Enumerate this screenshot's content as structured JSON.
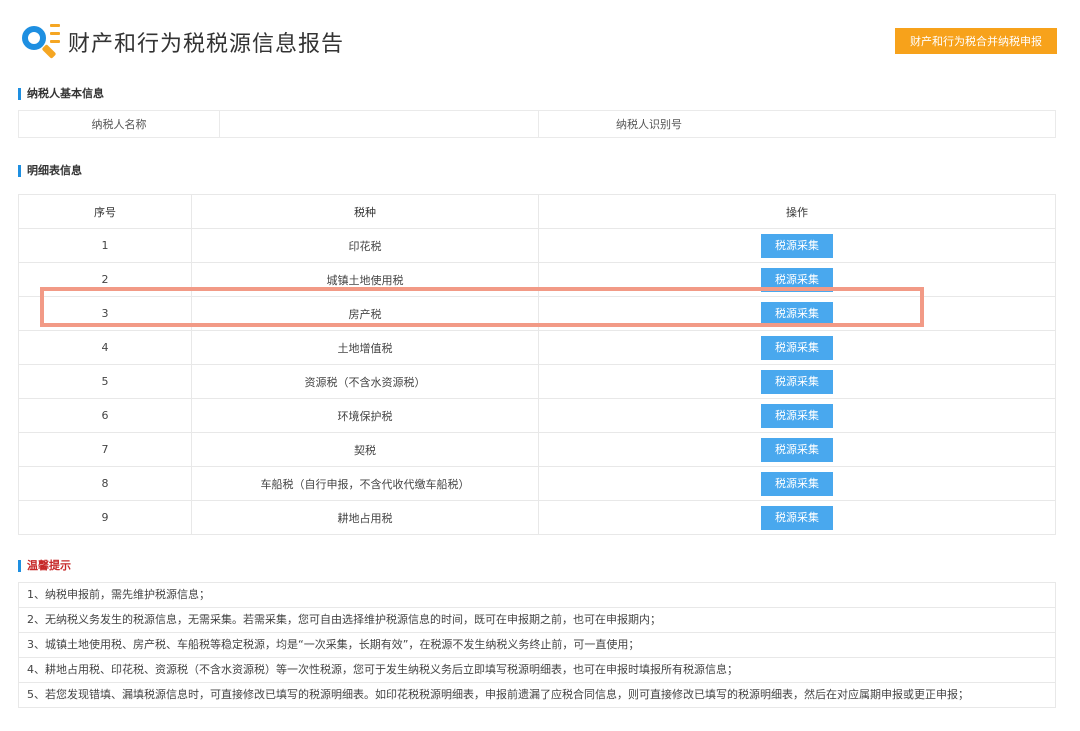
{
  "header": {
    "title": "财产和行为税税源信息报告",
    "merge_button": "财产和行为税合并纳税申报",
    "logo_icon": "search-list-icon"
  },
  "taxpayer_section": {
    "title": "纳税人基本信息",
    "name_label": "纳税人名称",
    "id_label": "纳税人识别号"
  },
  "detail_section": {
    "title": "明细表信息",
    "columns": [
      "序号",
      "税种",
      "操作"
    ],
    "rows": [
      {
        "no": "1",
        "tax": "印花税",
        "action": "税源采集"
      },
      {
        "no": "2",
        "tax": "城镇土地使用税",
        "action": "税源采集"
      },
      {
        "no": "3",
        "tax": "房产税",
        "action": "税源采集"
      },
      {
        "no": "4",
        "tax": "土地增值税",
        "action": "税源采集"
      },
      {
        "no": "5",
        "tax": "资源税（不含水资源税）",
        "action": "税源采集"
      },
      {
        "no": "6",
        "tax": "环境保护税",
        "action": "税源采集"
      },
      {
        "no": "7",
        "tax": "契税",
        "action": "税源采集"
      },
      {
        "no": "8",
        "tax": "车船税（自行申报，不含代收代缴车船税）",
        "action": "税源采集"
      },
      {
        "no": "9",
        "tax": "耕地占用税",
        "action": "税源采集"
      }
    ]
  },
  "tips_section": {
    "title": "温馨提示",
    "items": [
      "1、纳税申报前，需先维护税源信息；",
      "2、无纳税义务发生的税源信息，无需采集。若需采集，您可自由选择维护税源信息的时间，既可在申报期之前，也可在申报期内；",
      "3、城镇土地使用税、房产税、车船税等稳定税源，均是“一次采集，长期有效”，在税源不发生纳税义务终止前，可一直使用；",
      "4、耕地占用税、印花税、资源税（不含水资源税）等一次性税源，您可于发生纳税义务后立即填写税源明细表，也可在申报时填报所有税源信息；",
      "5、若您发现错填、漏填税源信息时，可直接修改已填写的税源明细表。如印花税税源明细表，申报前遗漏了应税合同信息，则可直接修改已填写的税源明细表，然后在对应属期申报或更正申报；"
    ]
  },
  "colors": {
    "accent": "#1e8fe1",
    "merge_button": "#f7a21b",
    "action_button": "#49a8ee",
    "highlight": "#f29a86",
    "tips_title": "#c62828"
  }
}
